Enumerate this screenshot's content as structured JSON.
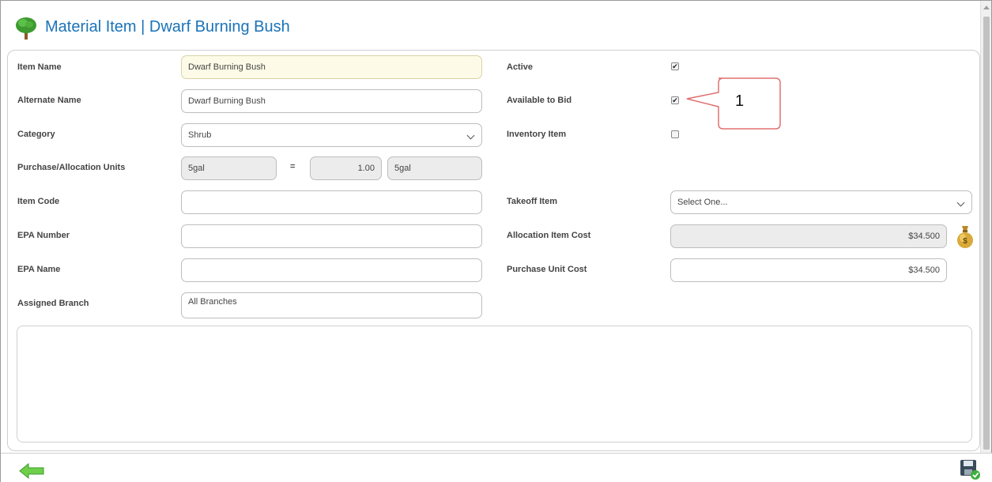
{
  "header": {
    "title": "Material Item | Dwarf Burning Bush",
    "icon": "tree-icon"
  },
  "form": {
    "item_name_label": "Item Name",
    "item_name_value": "Dwarf Burning Bush",
    "alternate_name_label": "Alternate Name",
    "alternate_name_value": "Dwarf Burning Bush",
    "category_label": "Category",
    "category_value": "Shrub",
    "units_label": "Purchase/Allocation Units",
    "purchase_unit": "5gal",
    "equals": "=",
    "conversion_factor": "1.00",
    "allocation_unit": "5gal",
    "item_code_label": "Item Code",
    "item_code_value": "",
    "epa_number_label": "EPA Number",
    "epa_number_value": "",
    "epa_name_label": "EPA Name",
    "epa_name_value": "",
    "assigned_branch_label": "Assigned Branch",
    "assigned_branch_value": "All Branches",
    "active_label": "Active",
    "active_checked": true,
    "available_to_bid_label": "Available to Bid",
    "available_to_bid_checked": true,
    "inventory_item_label": "Inventory Item",
    "inventory_item_checked": false,
    "takeoff_item_label": "Takeoff Item",
    "takeoff_item_value": "Select One...",
    "allocation_cost_label": "Allocation Item Cost",
    "allocation_cost_value": "$34.500",
    "purchase_cost_label": "Purchase Unit Cost",
    "purchase_cost_value": "$34.500",
    "notes_value": ""
  },
  "annotation": {
    "callout_number": "1"
  },
  "footer": {
    "back_icon": "back-arrow-icon",
    "save_icon": "save-icon"
  },
  "colors": {
    "title": "#1a73b8",
    "callout_border": "#e07070"
  }
}
